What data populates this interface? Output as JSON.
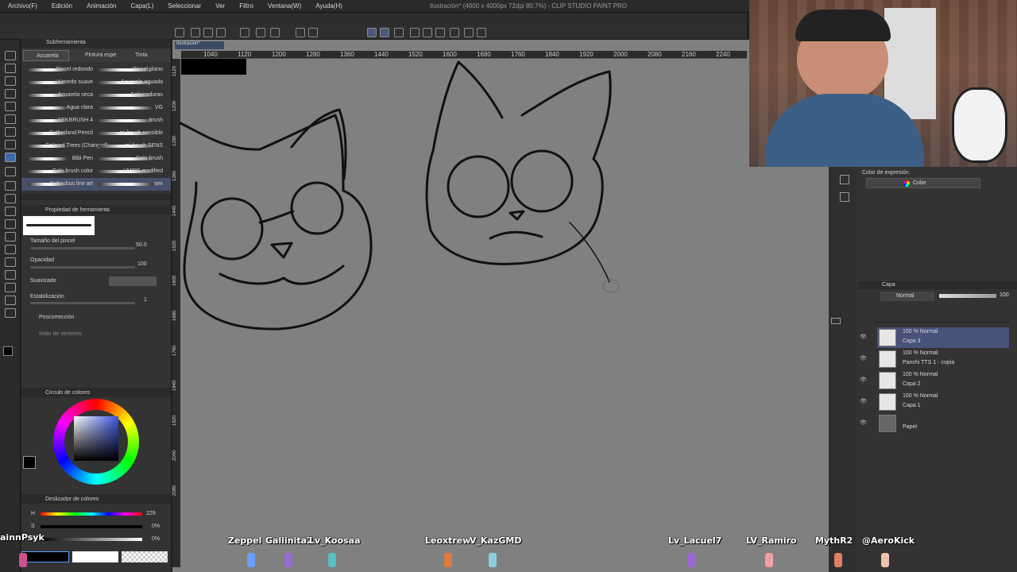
{
  "menu": [
    "Archivo(F)",
    "Edición",
    "Animación",
    "Capa(L)",
    "Seleccionar",
    "Ver",
    "Filtro",
    "Ventana(W)",
    "Ayuda(H)"
  ],
  "app_title": "Ilustración* (4000 x 4000px 72dpi 80.7%) - CLIP STUDIO PAINT PRO",
  "doc_tab": "Ilustración*",
  "left_panel": {
    "subtool_header": "Subherramienta",
    "subtool_tabs": [
      "Acuarela",
      "Pintura espe",
      "Tinta"
    ],
    "brushes_left": [
      "Pincel redondo",
      "Húmedo suave",
      "Acuarela seca",
      "Agua clara",
      "SEKBRUSH 4",
      "Sutherland Pencil",
      "Colored Trees (Changed)",
      "Bibi Pen",
      "Colo.brush color",
      "Subsubus line art"
    ],
    "brushes_right": [
      "Pincel plano",
      "Acuarela aguada",
      "Salpicaduras",
      "VG",
      "brush",
      "mi brush sensible",
      "mi brush SENS",
      "Colo brush",
      "HMOG modified",
      "sex"
    ],
    "tool_property_header": "Propiedad de herramienta",
    "brush_size_label": "Tamaño del pincel",
    "brush_size_value": "50.0",
    "opacity_label": "Opacidad",
    "opacity_value": "100",
    "smoothing_label": "Suavizado",
    "stabilization_label": "Estabilización",
    "stabilization_value": "1",
    "post_correction_label": "Poscorrección",
    "vector_magnet_label": "Imán de vectores",
    "color_wheel_header": "Círculo de colores",
    "color_slider_header": "Deslizador de colores",
    "h_label": "H",
    "h_value": "229",
    "s_label": "S",
    "s_value": "0%",
    "v_label": "V",
    "v_value": "0%",
    "main_color": "#000000",
    "sub_color": "#ffffff"
  },
  "ruler_ticks": [
    "1040",
    "1120",
    "1200",
    "1280",
    "1360",
    "1440",
    "1520",
    "1600",
    "1680",
    "1760",
    "1840",
    "1920",
    "2000",
    "2080",
    "2160",
    "2240"
  ],
  "vruler_ticks": [
    "1120",
    "1200",
    "1280",
    "1360",
    "1440",
    "1520",
    "1600",
    "1680",
    "1760",
    "1840",
    "1920",
    "2000",
    "2080"
  ],
  "right_panel": {
    "expression_label": "Color de expresión",
    "expression_value": "Color",
    "layer_tab": "Capa",
    "blend_mode": "Normal",
    "opacity": "100",
    "layers": [
      {
        "mode": "100 % Normal",
        "name": "Capa 3",
        "selected": true
      },
      {
        "mode": "100 % Normal",
        "name": "Panchi TTS 1 - copia",
        "selected": false
      },
      {
        "mode": "100 % Normal",
        "name": "Capa 2",
        "selected": false
      },
      {
        "mode": "100 % Normal",
        "name": "Capa 1",
        "selected": false
      },
      {
        "mode": "",
        "name": "Papel",
        "selected": false
      }
    ]
  },
  "chat_names": [
    "Zeppel",
    "Gallinita2",
    "Lv_Koosaa",
    "Leoxtrew",
    "V_KazGMD",
    "Lv_Lacuel7",
    "LV_Ramiro",
    "MythR2",
    "@AeroKick",
    "ainnPsyk"
  ]
}
